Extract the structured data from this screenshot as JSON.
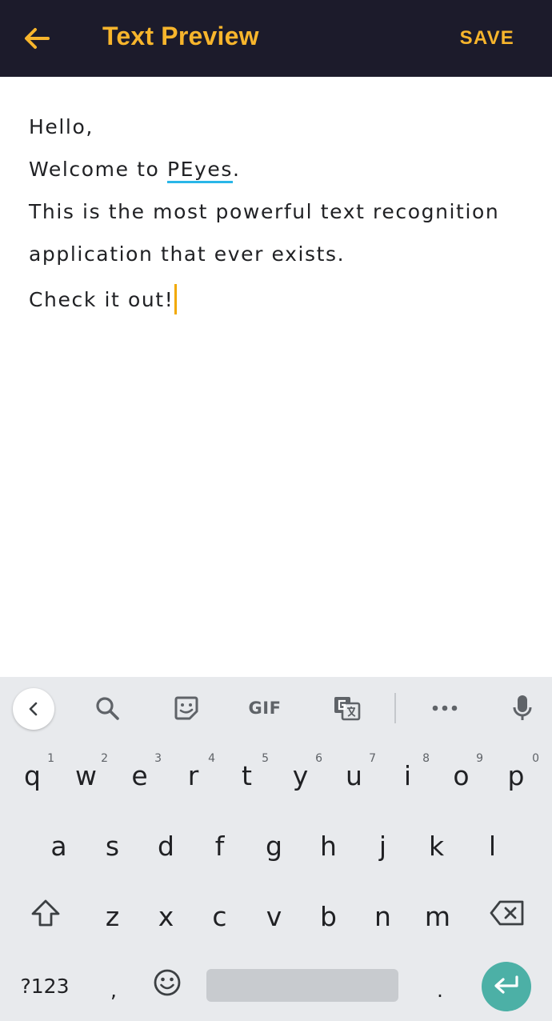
{
  "app_bar": {
    "back_icon": "arrow-left-icon",
    "title": "Text Preview",
    "save_label": "SAVE",
    "accent_color": "#f7b52c",
    "background_color": "#1c1b2b"
  },
  "editor": {
    "lines": [
      "Hello,",
      "Welcome to ",
      "This is the most powerful text recognition",
      "application that ever exists.",
      "Check it out!"
    ],
    "misspelled_word": "PEyes",
    "after_misspelled": ".",
    "spellcheck_underline_color": "#29b6e8",
    "cursor_color": "#f2a900"
  },
  "keyboard": {
    "toolbar": {
      "icons": [
        "chevron-left-icon",
        "search-icon",
        "sticker-icon",
        "gif-icon",
        "translate-icon",
        "more-icon",
        "mic-icon"
      ],
      "gif_label": "GIF",
      "more_label": "•••"
    },
    "rows": [
      [
        {
          "k": "q",
          "h": "1"
        },
        {
          "k": "w",
          "h": "2"
        },
        {
          "k": "e",
          "h": "3"
        },
        {
          "k": "r",
          "h": "4"
        },
        {
          "k": "t",
          "h": "5"
        },
        {
          "k": "y",
          "h": "6"
        },
        {
          "k": "u",
          "h": "7"
        },
        {
          "k": "i",
          "h": "8"
        },
        {
          "k": "o",
          "h": "9"
        },
        {
          "k": "p",
          "h": "0"
        }
      ],
      [
        {
          "k": "a"
        },
        {
          "k": "s"
        },
        {
          "k": "d"
        },
        {
          "k": "f"
        },
        {
          "k": "g"
        },
        {
          "k": "h"
        },
        {
          "k": "j"
        },
        {
          "k": "k"
        },
        {
          "k": "l"
        }
      ],
      [
        {
          "k": "z"
        },
        {
          "k": "x"
        },
        {
          "k": "c"
        },
        {
          "k": "v"
        },
        {
          "k": "b"
        },
        {
          "k": "n"
        },
        {
          "k": "m"
        }
      ]
    ],
    "bottom_row": {
      "symbols_label": "?123",
      "comma_label": ",",
      "period_label": ".",
      "emoji_icon": "emoji-icon",
      "enter_icon": "enter-icon",
      "enter_color": "#4cb0a6"
    },
    "shift_icon": "shift-icon",
    "backspace_icon": "backspace-icon"
  }
}
